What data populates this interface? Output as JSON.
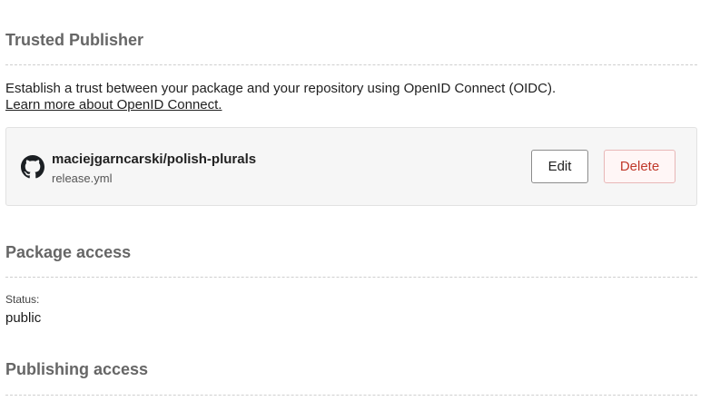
{
  "trusted_publisher": {
    "heading": "Trusted Publisher",
    "description": "Establish a trust between your package and your repository using OpenID Connect (OIDC).",
    "learn_more_link": "Learn more about OpenID Connect.",
    "publisher": {
      "icon": "github-icon",
      "repository": "maciejgarncarski/polish-plurals",
      "workflow": "release.yml",
      "edit_label": "Edit",
      "delete_label": "Delete"
    }
  },
  "package_access": {
    "heading": "Package access",
    "status_label": "Status:",
    "status_value": "public"
  },
  "publishing_access": {
    "heading": "Publishing access"
  },
  "colors": {
    "heading": "#666666",
    "delete_text": "#c0392b",
    "card_bg": "#f6f6f6"
  }
}
